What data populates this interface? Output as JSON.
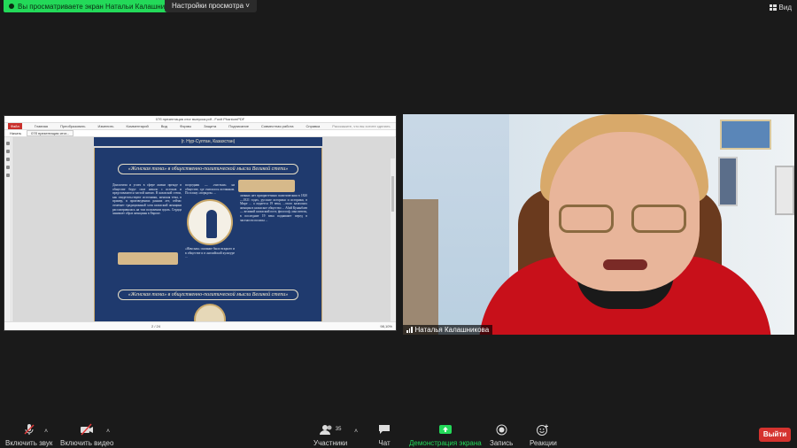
{
  "top": {
    "share_banner": "Вы просматриваете экран Натальи Калашнико",
    "view_options": "Настройки просмотра ˅",
    "view_button": "Вид"
  },
  "pdf": {
    "window_title": "07б презентация итог выпуска.pdf - Foxit PhantomPDF",
    "menu": [
      "Файл",
      "Главная",
      "Преобразовать",
      "Изменить",
      "Комментарий",
      "Вид",
      "Формы",
      "Защита",
      "Подписание",
      "Справка",
      "Совместная работа",
      "Справка"
    ],
    "tab_label": "07б презентация итог...",
    "start_tab": "Начать",
    "search_placeholder": "Расскажите, что вы хотите сделать",
    "page_header": "(г. Нур-Султан, Казахстан)",
    "banner_text": "«Женская тема» в общественно-политической мысли Великой степи»",
    "col1": "Диалогизм и успех в сфере жизни прежде в обществе берут свое начало с истоков и представляются частой нитью. В казахской степи, как свидетельствуют источники, женская тема, в пример, в произведениях ранних лет, сейчас отмечает традиционный хотя казахский женщина рассматривалась на том положении вдоль. Сердца занимает образ женщины в Европе.",
    "col2": "посредник — «чистым» на обществе, где считалось истинным. По плану «порядок» ...",
    "col3": "личных нет приоритетным политическим в 1820—1821 годах, русские историки и историки, в Мире ... а издается 19 века, ...этого казахских женщин в казахское общество ... Абай Кунанбаев — великий казахский поэт, философ, мыслитель, в последние 19 века поднимает перед в частности полисы ...",
    "col4": "«Женская» сказание было вскрыто и в обществе и в английской культуре ...",
    "page_counter": "2 / 24",
    "zoom": "98,10%"
  },
  "video": {
    "participant_name": "Наталья Калашникова"
  },
  "toolbar": {
    "unmute_label": "Включить звук",
    "start_video_label": "Включить видео",
    "participants_label": "Участники",
    "participants_count": "35",
    "chat_label": "Чат",
    "share_label": "Демонстрация экрана",
    "record_label": "Запись",
    "reactions_label": "Реакции",
    "leave_label": "Выйти"
  },
  "colors": {
    "share_green": "#23d959",
    "leave_red": "#d5332f",
    "pdf_page_navy": "#1f3a6e"
  }
}
